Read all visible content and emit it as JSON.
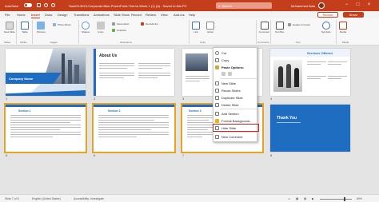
{
  "titlebar": {
    "autosave_label": "AutoSave",
    "doc_title": "Sam03-3013-Corporate-Blue-PowerPoint-Theme-Week 1 (1) (A) - Saved to this PC",
    "search_placeholder": "Search",
    "user_name": "Muhammed Alaa",
    "minimize": "−",
    "maximize": "□",
    "close": "×"
  },
  "tabs": [
    "File",
    "Home",
    "Insert",
    "Draw",
    "Design",
    "Transitions",
    "Animations",
    "Slide Show",
    "Record",
    "Review",
    "View",
    "Add-ins",
    "Help"
  ],
  "active_tab": "Insert",
  "record_label": "Record",
  "share_label": "Share",
  "ribbon": {
    "new_slide": "New Slide",
    "table": "Table",
    "pictures": "Pictures",
    "photo_album": "Photo Album",
    "shapes": "Shapes",
    "icons": "Icons",
    "screenshot": "Screenshot",
    "smartart": "SmartArt",
    "add_ins": "Get Add-ins",
    "link": "Link",
    "action": "Action",
    "comment": "Comment",
    "text_box": "Text Box",
    "header_footer": "Header & Footer",
    "symbols": "Symbols",
    "media": "Media",
    "groups": [
      "Slides",
      "Tables",
      "Images",
      "Illustrations",
      "Links",
      "Comments",
      "Text",
      "Media"
    ]
  },
  "slides": [
    {
      "number": "1",
      "title": "Company Name"
    },
    {
      "number": "2",
      "title": "About Us"
    },
    {
      "number": "3",
      "title": ""
    },
    {
      "number": "4",
      "title": "Services Offered"
    },
    {
      "number": "5",
      "title": "Section 1"
    },
    {
      "number": "6",
      "title": "Section 2"
    },
    {
      "number": "7",
      "title": "Section 3"
    },
    {
      "number": "8",
      "title": "Thank You"
    }
  ],
  "context_menu": {
    "items": [
      "Cut",
      "Copy",
      "Paste Options:",
      "New Slide",
      "Reuse Slides",
      "Duplicate Slide",
      "Delete Slide",
      "Add Section",
      "Format Background...",
      "Hide Slide",
      "New Comment"
    ],
    "highlighted": "Hide Slide"
  },
  "status": {
    "slide_info": "Slide 7 of 8",
    "language": "English (United States)",
    "accessibility": "Accessibility: Investigate",
    "zoom": "69%"
  },
  "colors": {
    "accent": "#c43e1c",
    "selection": "#e8a31f",
    "slide_blue": "#1f6dc0"
  }
}
